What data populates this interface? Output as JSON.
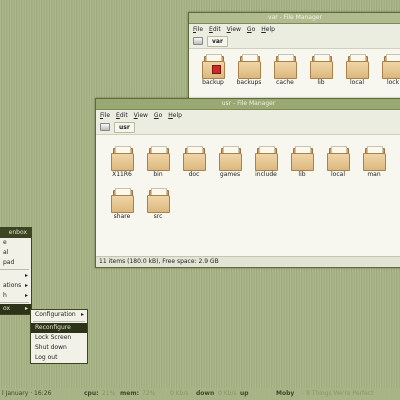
{
  "windows": {
    "back": {
      "title": "var - File Manager",
      "menus": [
        "File",
        "Edit",
        "View",
        "Go",
        "Help"
      ],
      "path": "var",
      "items": [
        "backup",
        "backups",
        "cache",
        "lib",
        "local",
        "lock"
      ]
    },
    "front": {
      "title": "usr - File Manager",
      "menus": [
        "File",
        "Edit",
        "View",
        "Go",
        "Help"
      ],
      "path": "usr",
      "items": [
        "X11R6",
        "bin",
        "doc",
        "games",
        "include",
        "lib",
        "local",
        "man",
        "share",
        "src"
      ],
      "status": "11 items (180.0 kB), Free space: 2.9 GB"
    }
  },
  "root_menu": {
    "header": "enbox",
    "items": [
      "e",
      "al",
      "pad",
      "ations",
      "h",
      "ox"
    ],
    "selected_item": "ox"
  },
  "submenu": {
    "items": [
      "Configuration",
      "Reconfigure",
      "Lock Screen",
      "Shut down",
      "Log out"
    ],
    "selected": "Reconfigure"
  },
  "panel": {
    "date": "l January · 16:26",
    "cpu_label": "cpu:",
    "cpu_value": "21%",
    "mem_label": "mem:",
    "mem_value": "72%",
    "down_prefix": "0 Kb/s",
    "down_label": "down",
    "up_prefix": "0 Kb/s",
    "up_label": "up",
    "music_artist": "Moby",
    "music_title": "- 8 Things We're Perfect"
  },
  "colors": {
    "desktop": "#a9b486",
    "titlebar": "#9aa874",
    "menu_selection": "#2c3318",
    "folder": "#dcb77f"
  },
  "icons": {
    "folder": "folder-icon",
    "drive": "drive-icon",
    "backup_badge": "error-badge-icon"
  }
}
